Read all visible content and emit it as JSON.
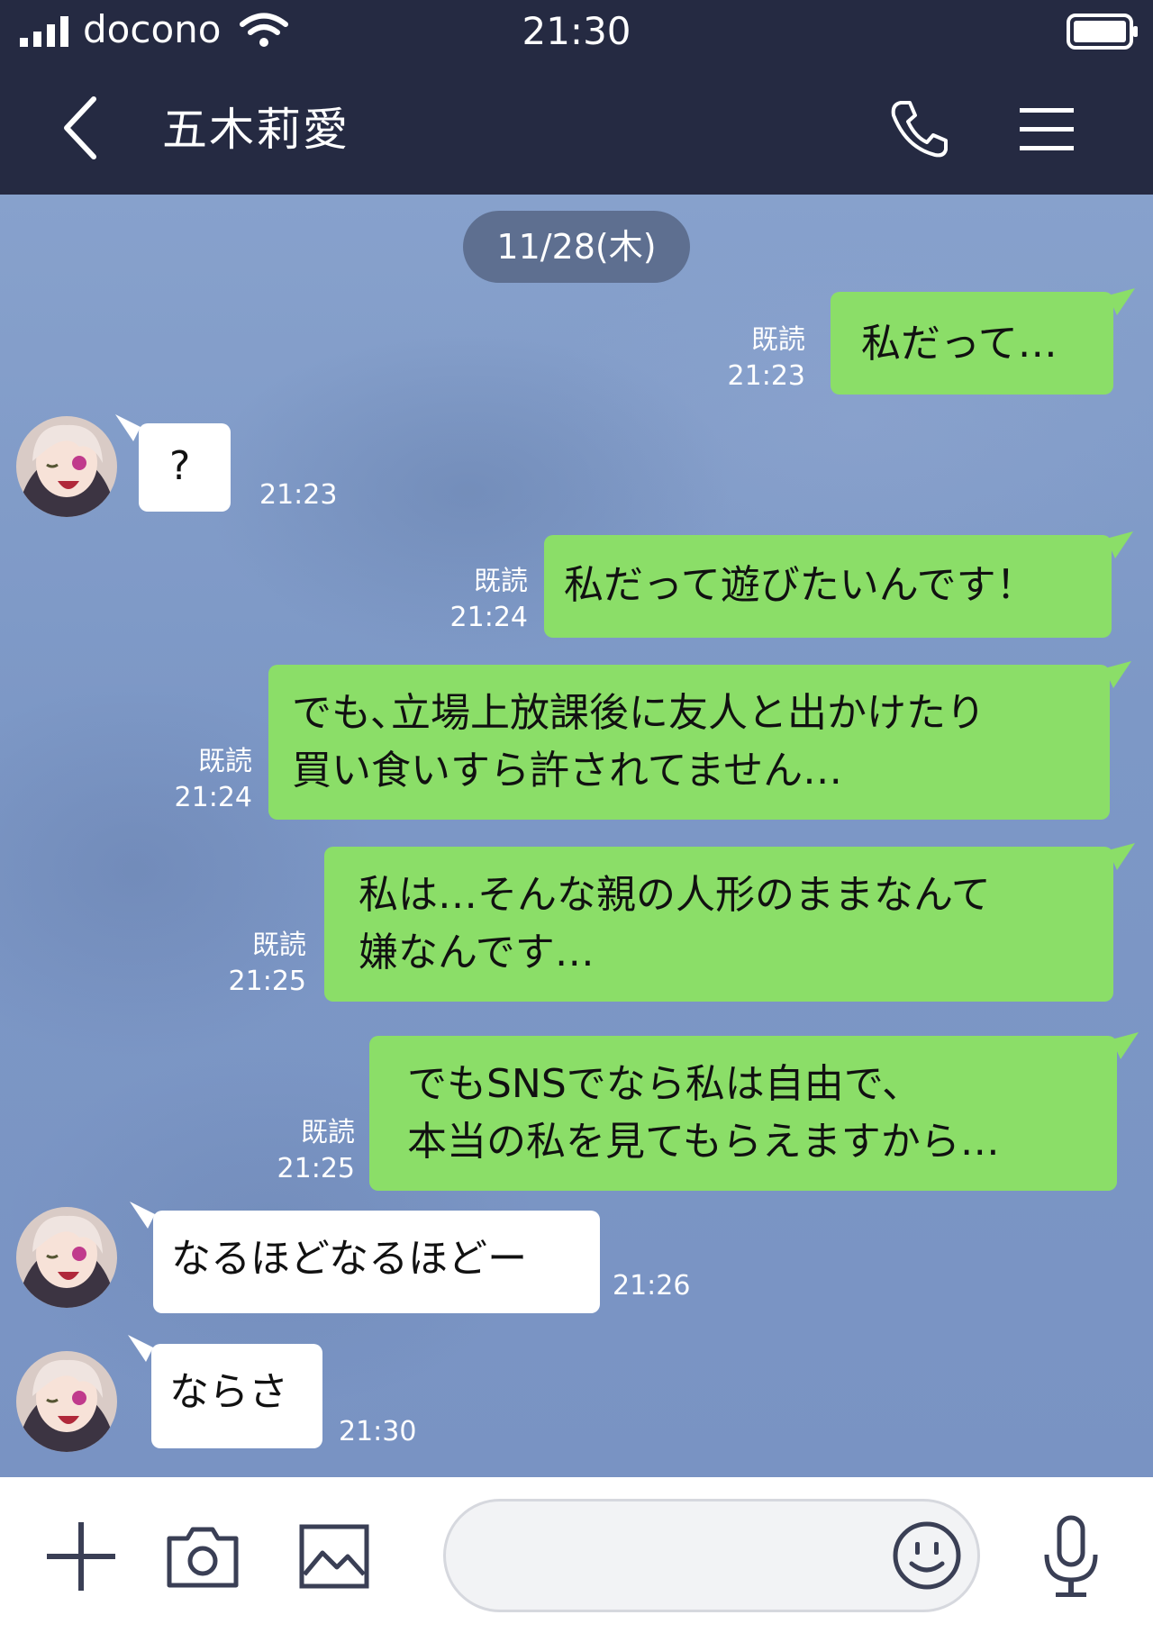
{
  "status_bar": {
    "carrier": "docono",
    "time": "21:30"
  },
  "header": {
    "contact_name": "五木莉愛"
  },
  "chat": {
    "date": "11/28(木)",
    "read_label": "既読",
    "messages": [
      {
        "side": "sent",
        "text": "私だって…",
        "read": "既読",
        "time": "21:23"
      },
      {
        "side": "received",
        "text": "?",
        "time": "21:23"
      },
      {
        "side": "sent",
        "text": "私だって遊びたいんです！",
        "read": "既読",
        "time": "21:24"
      },
      {
        "side": "sent",
        "lines": [
          "でも､立場上放課後に友人と出かけたり",
          "買い食いすら許されてません…"
        ],
        "read": "既読",
        "time": "21:24"
      },
      {
        "side": "sent",
        "lines": [
          "私は…そんな親の人形のままなんて",
          "嫌なんです…"
        ],
        "read": "既読",
        "time": "21:25"
      },
      {
        "side": "sent",
        "lines": [
          "でもSNSでなら私は自由で、",
          "本当の私を見てもらえますから…"
        ],
        "read": "既読",
        "time": "21:25"
      },
      {
        "side": "received",
        "text": "なるほどなるほどー",
        "time": "21:26"
      },
      {
        "side": "received",
        "text": "ならさ",
        "time": "21:30"
      }
    ]
  },
  "input_bar": {
    "message_value": ""
  },
  "colors": {
    "header_bg": "#252a42",
    "chat_bg": "#7f9bc8",
    "sent_bubble": "#8bde68",
    "received_bubble": "#ffffff",
    "date_pill": "#5e6f90"
  },
  "icons": {
    "status": [
      "signal-icon",
      "wifi-icon",
      "battery-icon"
    ],
    "header": [
      "back-icon",
      "phone-icon",
      "menu-icon"
    ],
    "input_bar": [
      "plus-icon",
      "camera-icon",
      "image-icon",
      "emoji-icon",
      "microphone-icon"
    ]
  }
}
